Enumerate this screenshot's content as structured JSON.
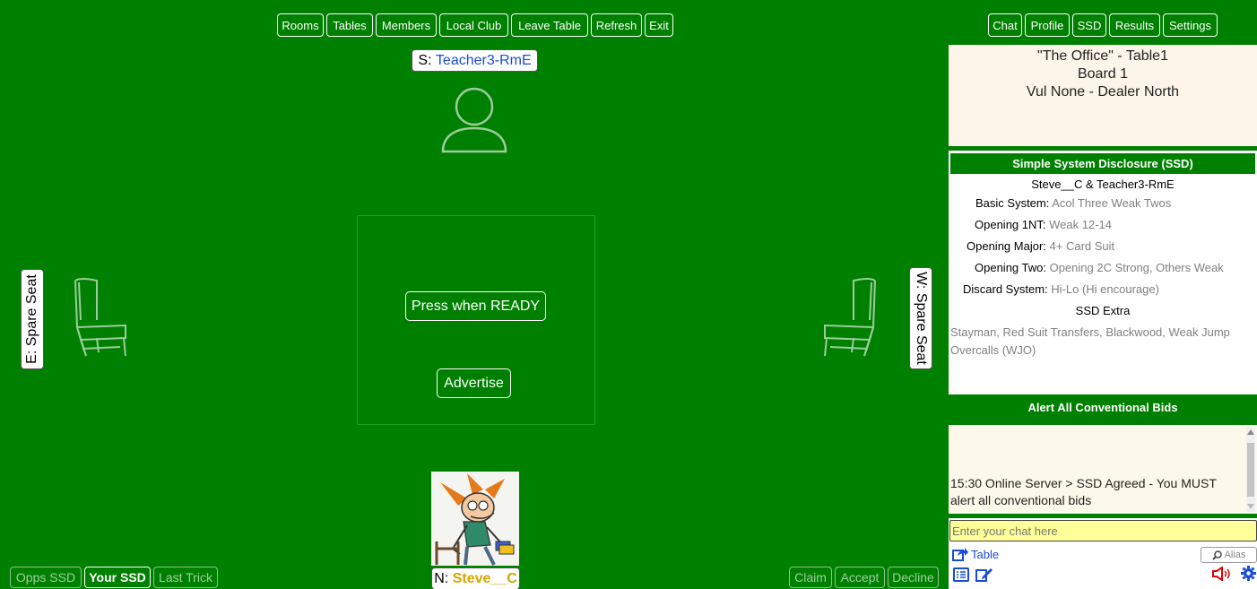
{
  "toolbar": {
    "left_buttons": [
      "Rooms",
      "Tables",
      "Members",
      "Local Club",
      "Leave Table",
      "Refresh",
      "Exit"
    ],
    "right_buttons": [
      "Chat",
      "Profile",
      "SSD",
      "Results",
      "Settings"
    ]
  },
  "seats": {
    "south": {
      "prefix": "S: ",
      "name": "Teacher3-RmE"
    },
    "east": {
      "label": "E: Spare Seat"
    },
    "west": {
      "label": "W: Spare Seat"
    },
    "north": {
      "prefix": "N: ",
      "name": "Steve__C"
    }
  },
  "center": {
    "ready_label": "Press when READY",
    "advertise_label": "Advertise"
  },
  "bottom_left_buttons": [
    "Opps SSD",
    "Your SSD",
    "Last Trick"
  ],
  "bottom_right_buttons": [
    "Claim",
    "Accept",
    "Decline"
  ],
  "board_info": {
    "line1": "\"The Office\" - Table1",
    "line2": "Board 1",
    "line3": "Vul None - Dealer North"
  },
  "ssd": {
    "header": "Simple System Disclosure (SSD)",
    "partnership": "Steve__C & Teacher3-RmE",
    "rows": [
      {
        "label": "Basic System:",
        "value": "Acol Three Weak Twos"
      },
      {
        "label": "Opening 1NT:",
        "value": "Weak 12-14"
      },
      {
        "label": "Opening Major:",
        "value": "4+ Card Suit"
      },
      {
        "label": "Opening Two:",
        "value": "Opening 2C Strong, Others Weak"
      },
      {
        "label": "Discard System:",
        "value": "Hi-Lo (Hi encourage)"
      }
    ],
    "extra_title": "SSD Extra",
    "extra_text_1": "Stayman, Red Suit Transfers, Blackwood, Weak Jump",
    "extra_text_2": "Overcalls (WJO)",
    "alert": "Alert All Conventional Bids"
  },
  "chat": {
    "message_1": "15:30 Online Server > SSD Agreed - You MUST",
    "message_2": "alert all conventional bids",
    "placeholder": "Enter your chat here",
    "table_label": "Table",
    "alias_label": "Alias"
  },
  "colors": {
    "felt": "#008000",
    "south_name": "#1a4bd6",
    "north_name": "#d9a400",
    "chat_input": "#ffff99"
  }
}
